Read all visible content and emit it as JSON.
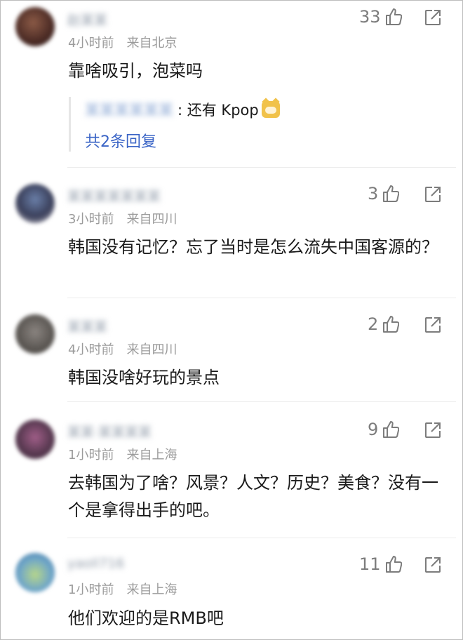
{
  "comments": [
    {
      "username": "赵某某",
      "time": "4小时前",
      "location": "来自北京",
      "likes": "33",
      "text": "靠啥吸引，泡菜吗",
      "reply_user": "某某某某某某",
      "reply_text": ": 还有 Kpop",
      "reply_emoji": "doge-emoji",
      "reply_count_label": "共2条回复"
    },
    {
      "username": "某某某某某某某",
      "time": "3小时前",
      "location": "来自四川",
      "likes": "3",
      "text": "韩国没有记忆？忘了当时是怎么流失中国客源的？"
    },
    {
      "username": "某某某",
      "time": "4小时前",
      "location": "来自四川",
      "likes": "2",
      "text": "韩国没啥好玩的景点"
    },
    {
      "username": "某某·某某某某",
      "time": "1小时前",
      "location": "来自上海",
      "likes": "9",
      "text": "去韩国为了啥？风景？人文？历史？美食？没有一个是拿得出手的吧。"
    },
    {
      "username": "yaoll716",
      "time": "1小时前",
      "location": "来自上海",
      "likes": "11",
      "text": "他们欢迎的是RMB吧"
    }
  ],
  "icons": {
    "like": "thumbs-up-icon",
    "share": "share-icon"
  },
  "colors": {
    "link": "#3a64c6",
    "meta": "#9b9b9b",
    "icon": "#7c7c7c"
  }
}
